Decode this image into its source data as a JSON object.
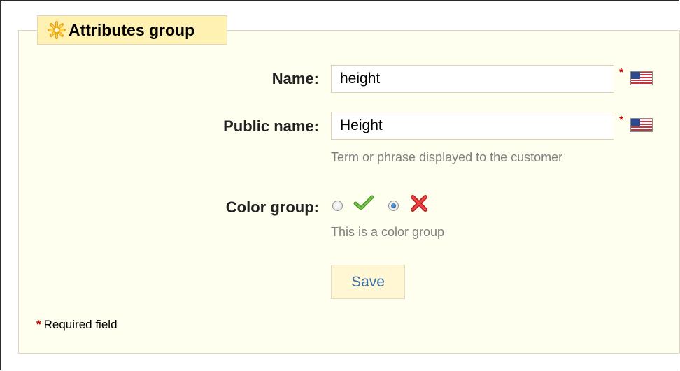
{
  "form": {
    "legend": "Attributes group",
    "legend_icon": "asterisk-gear-icon",
    "fields": {
      "name": {
        "label": "Name:",
        "value": "height",
        "required_marker": "*",
        "flag_icon": "us-flag-icon"
      },
      "public_name": {
        "label": "Public name:",
        "value": "Height",
        "required_marker": "*",
        "flag_icon": "us-flag-icon",
        "hint": "Term or phrase displayed to the customer"
      },
      "color_group": {
        "label": "Color group:",
        "options": [
          {
            "icon": "green-check-icon",
            "selected": false
          },
          {
            "icon": "red-x-icon",
            "selected": true
          }
        ],
        "hint": "This is a color group"
      }
    },
    "save_label": "Save",
    "required_star": "*",
    "required_note": "Required field"
  },
  "colors": {
    "panel_bg": "#fffff0",
    "legend_bg": "#fff1b2",
    "border": "#dfd5c3",
    "required": "#cc0000",
    "button_text": "#3a6ea5"
  }
}
